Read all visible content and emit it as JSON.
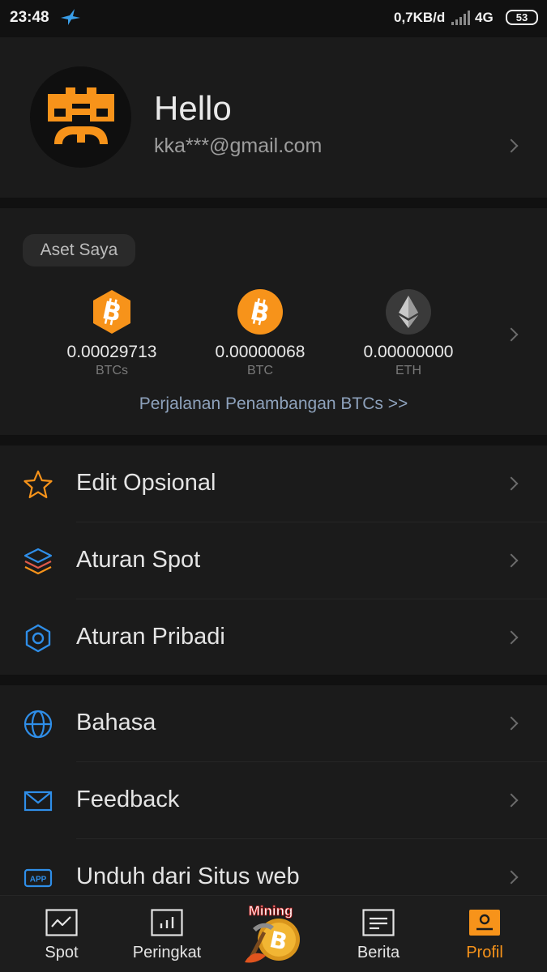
{
  "status_bar": {
    "time": "23:48",
    "speed": "0,7KB/d",
    "network": "4G",
    "battery": "53"
  },
  "profile": {
    "greeting": "Hello",
    "email": "kka***@gmail.com"
  },
  "assets": {
    "title": "Aset Saya",
    "items": [
      {
        "value": "0.00029713",
        "unit": "BTCs",
        "icon": "btcs-hexagon-icon"
      },
      {
        "value": "0.00000068",
        "unit": "BTC",
        "icon": "bitcoin-icon"
      },
      {
        "value": "0.00000000",
        "unit": "ETH",
        "icon": "ethereum-icon"
      }
    ],
    "mining_link": "Perjalanan Penambangan BTCs >>"
  },
  "menu_group_1": [
    {
      "label": "Edit Opsional",
      "icon": "star-icon"
    },
    {
      "label": "Aturan Spot",
      "icon": "layers-icon"
    },
    {
      "label": "Aturan Pribadi",
      "icon": "hexagon-icon"
    }
  ],
  "menu_group_2": [
    {
      "label": "Bahasa",
      "icon": "globe-icon"
    },
    {
      "label": "Feedback",
      "icon": "mail-icon"
    },
    {
      "label": "Unduh dari Situs web",
      "icon": "app-icon",
      "icon_text": "APP"
    }
  ],
  "bottom_nav": {
    "items": [
      {
        "label": "Spot",
        "icon": "chart-line-icon"
      },
      {
        "label": "Peringkat",
        "icon": "bar-chart-icon"
      },
      {
        "label": "Mining",
        "icon": "mining-bitcoin-icon"
      },
      {
        "label": "Berita",
        "icon": "news-icon"
      },
      {
        "label": "Profil",
        "icon": "profile-icon"
      }
    ],
    "active": "Profil"
  },
  "colors": {
    "accent": "#f7931a",
    "link": "#8ea2bc",
    "blue_icon": "#2f8ee8",
    "background": "#111111",
    "card": "#1b1b1b"
  }
}
